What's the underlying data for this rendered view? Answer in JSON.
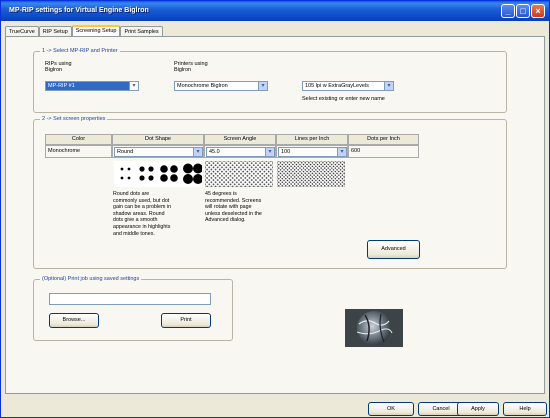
{
  "window": {
    "title": "MP-RIP settings for Virtual Engine Biglron",
    "controls": [
      "minimize",
      "maximize",
      "close"
    ]
  },
  "tabs": [
    {
      "label": "TrueCurve",
      "active": false
    },
    {
      "label": "RIP Setup",
      "active": false
    },
    {
      "label": "Screening Setup",
      "active": true
    },
    {
      "label": "Print Samples",
      "active": false
    }
  ],
  "section1": {
    "legend": "1 -> Select MP-RIP and Printer",
    "rips_label_line1": "RIPs using",
    "rips_label_line2": "Biglron",
    "rip_value": "MP-RIP #1",
    "printers_label_line1": "Printers using",
    "printers_label_line2": "Biglron",
    "printer_value": "Monochrome Biglron",
    "preset_value": "105 lpi w ExtraGrayLevels",
    "preset_hint": "Select existing or enter new name"
  },
  "section2": {
    "legend": "2 -> Set screen properties",
    "columns": [
      "Color",
      "Dot Shape",
      "Screen Angle",
      "Lines per Inch",
      "Dots per Inch"
    ],
    "row": {
      "color": "Monochrome",
      "dot_shape": "Round",
      "screen_angle": "45.0",
      "lpi": "100",
      "dpi": "600"
    },
    "dot_desc": "Round dots are commonly used, but dot gain can be a problem in shadow areas. Round dots give a smooth appearance in highlights and middle tones.",
    "angle_desc": "45 degrees is recommended. Screens will rotate with page unless deselected in the Advanced dialog.",
    "advanced_label": "Advanced"
  },
  "section3": {
    "legend": "(Optional) Print job using saved settings",
    "file_value": "",
    "browse_label": "Browse...",
    "print_label": "Print"
  },
  "footer": {
    "ok_label": "OK",
    "cancel_label": "Cancel",
    "apply_label": "Apply",
    "help_label": "Help"
  }
}
